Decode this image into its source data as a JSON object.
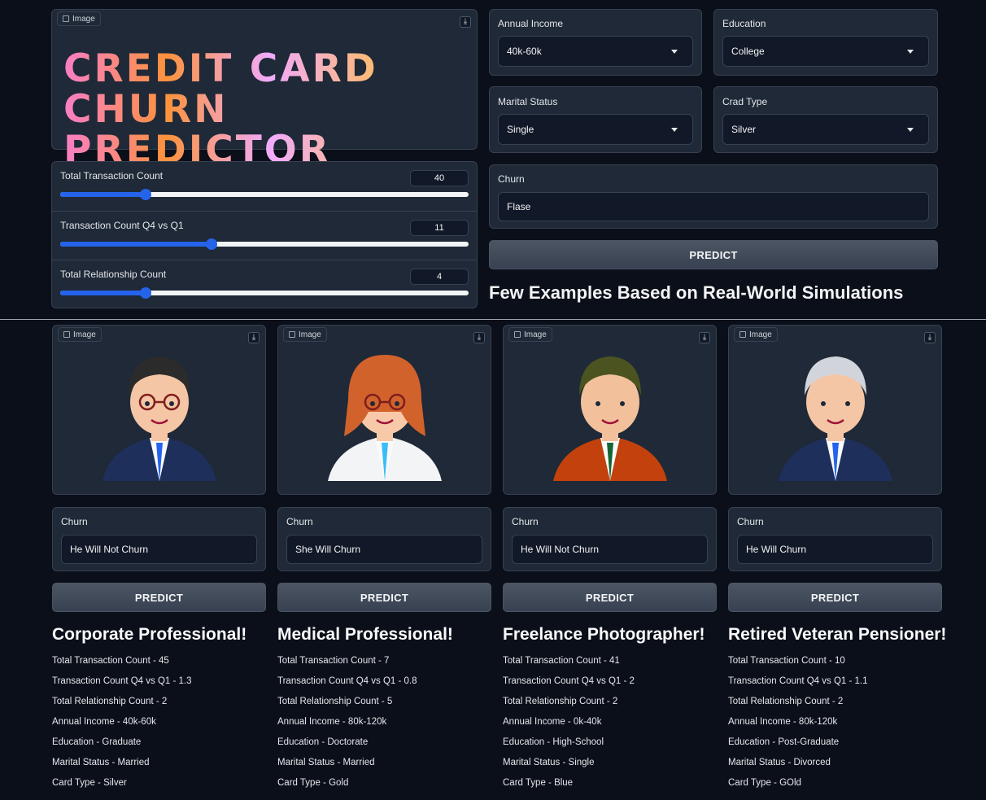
{
  "header_image": {
    "tag": "Image",
    "title_line1": "CREDIT CARD",
    "title_line2": "CHURN PREDICTOR"
  },
  "sliders": [
    {
      "label": "Total Transaction Count",
      "value": "40",
      "fraction": 0.21
    },
    {
      "label": "Transaction Count Q4 vs Q1",
      "value": "11",
      "fraction": 0.37
    },
    {
      "label": "Total Relationship Count",
      "value": "4",
      "fraction": 0.21
    }
  ],
  "dropdowns": {
    "income": {
      "label": "Annual Income",
      "value": "40k-60k"
    },
    "education": {
      "label": "Education",
      "value": "College"
    },
    "marital": {
      "label": "Marital Status",
      "value": "Single"
    },
    "card": {
      "label": "Crad Type",
      "value": "Silver"
    }
  },
  "churn": {
    "label": "Churn",
    "value": "Flase"
  },
  "predict_label": "PREDICT",
  "examples_heading": "Few Examples Based on Real-World Simulations",
  "examples": [
    {
      "tag": "Image",
      "churn_label": "Churn",
      "churn_value": "He Will Not Churn",
      "predict": "PREDICT",
      "title": "Corporate Professional!",
      "lines": [
        "Total Transaction Count - 45",
        "Transaction Count Q4 vs Q1 - 1.3",
        "Total Relationship Count - 2",
        "Annual Income - 40k-60k",
        "Education - Graduate",
        "Marital Status - Married",
        "Card Type - Silver"
      ]
    },
    {
      "tag": "Image",
      "churn_label": "Churn",
      "churn_value": "She Will Churn",
      "predict": "PREDICT",
      "title": "Medical Professional!",
      "lines": [
        "Total Transaction Count - 7",
        "Transaction Count Q4 vs Q1 - 0.8",
        "Total Relationship Count - 5",
        "Annual Income - 80k-120k",
        "Education - Doctorate",
        "Marital Status - Married",
        "Card Type - Gold"
      ]
    },
    {
      "tag": "Image",
      "churn_label": "Churn",
      "churn_value": "He Will Not Churn",
      "predict": "PREDICT",
      "title": "Freelance Photographer!",
      "lines": [
        "Total Transaction Count - 41",
        "Transaction Count Q4 vs Q1 - 2",
        "Total Relationship Count - 2",
        "Annual Income - 0k-40k",
        "Education - High-School",
        "Marital Status - Single",
        "Card Type - Blue"
      ]
    },
    {
      "tag": "Image",
      "churn_label": "Churn",
      "churn_value": "He Will Churn",
      "predict": "PREDICT",
      "title": "Retired Veteran Pensioner!",
      "lines": [
        "Total Transaction Count - 10",
        "Transaction Count Q4 vs Q1 - 1.1",
        "Total Relationship Count - 2",
        "Annual Income - 80k-120k",
        "Education - Post-Graduate",
        "Marital Status - Divorced",
        "Card Type - GOld"
      ]
    }
  ]
}
